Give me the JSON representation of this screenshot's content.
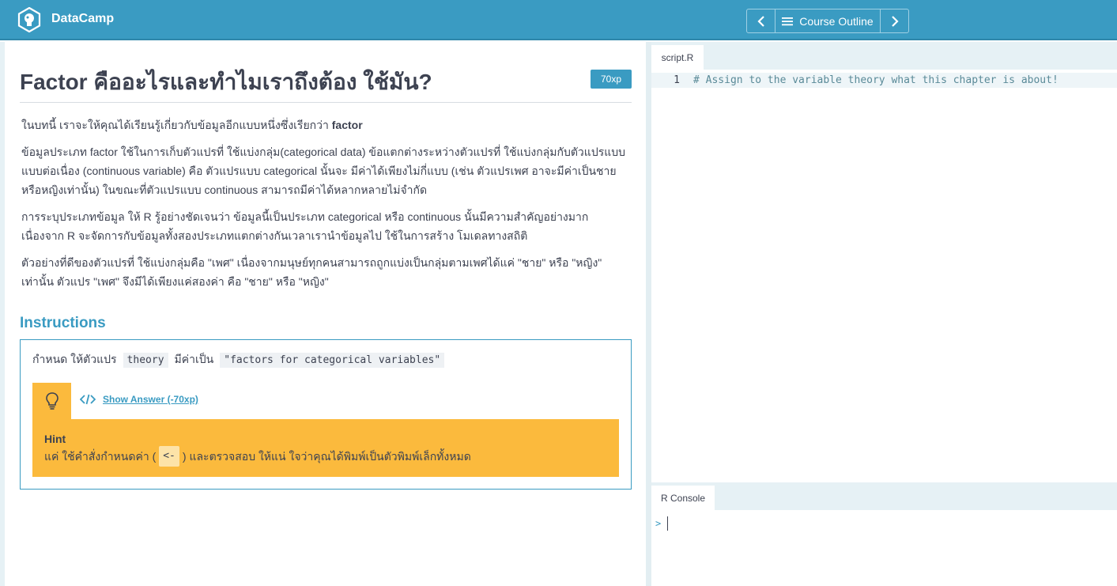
{
  "header": {
    "brand": "DataCamp",
    "nav_label": "Course Outline",
    "icons": [
      "datacamp-logo-icon",
      "chevron-left-icon",
      "menu-icon",
      "chevron-right-icon"
    ]
  },
  "exercise": {
    "title": "Factor คืออะไรและทำไมเราถึงต้อง ใช้มัน?",
    "xp": "70xp",
    "paragraphs": {
      "p1_text": "ในบทนี้ เราจะให้คุณได้เรียนรู้เกี่ยวกับข้อมูลอีกแบบหนึ่งซึ่งเรียกว่า ",
      "p1_bold": "factor",
      "p2": "ข้อมูลประเภท factor ใช้ในการเก็บตัวแปรที่ ใช้แบ่งกลุ่ม(categorical data) ข้อแตกต่างระหว่างตัวแปรที่ ใช้แบ่งกลุ่มกับตัวแปรแบบแบบต่อเนื่อง (continuous variable) คือ ตัวแปรแบบ categorical นั้นจะ มีค่าได้เพียงไม่กี่แบบ (เช่น ตัวแปรเพศ อาจะมีค่าเป็นชายหรือหญิงเท่านั้น) ในขณะที่ตัวแปรแบบ continuous สามารถมีค่าได้หลากหลายไม่จำกัด",
      "p3": "การระบุประเภทข้อมูล ให้ R รู้อย่างชัดเจนว่า ข้อมูลนี้เป็นประเภท categorical หรือ continuous นั้นมีความสำคัญอย่างมาก เนื่องจาก R จะจัดการกับข้อมูลทั้งสองประเภทแตกต่างกันเวลาเรานำข้อมูลไป ใช้ในการสร้าง โมเดลทางสถิติ",
      "p4": "ตัวอย่างที่ดีของตัวแปรที่ ใช้แบ่งกลุ่มคือ \"เพศ\" เนื่องจากมนุษย์ทุกคนสามารถถูกแบ่งเป็นกลุ่มตามเพศได้แค่ \"ชาย\" หรือ \"หญิง\" เท่านั้น ตัวแปร \"เพศ\" จึงมีได้เพียงแค่สองค่า คือ \"ชาย\" หรือ \"หญิง\""
    }
  },
  "instructions": {
    "heading": "Instructions",
    "text_before": "กำหนด ให้ตัวแปร",
    "code_var": "theory",
    "text_middle": "มีค่าเป็น",
    "code_value": "\"factors for categorical variables\"",
    "show_answer": "Show Answer (-70xp)",
    "hint_title": "Hint",
    "hint_before": "แค่ ใช้คำสั่งกำหนดค่า (",
    "hint_code": "<-",
    "hint_after": ") และตรวจสอบ ให้แน่ ใจว่าคุณได้พิมพ์เป็นตัวพิมพ์เล็กทั้งหมด"
  },
  "editor": {
    "tab": "script.R",
    "line_number": "1",
    "code": "# Assign to the variable theory what this chapter is about!"
  },
  "console": {
    "tab": "R Console",
    "prompt": ">"
  },
  "colors": {
    "brand_blue": "#3a9bc2",
    "hint_orange": "#fbba3d"
  }
}
